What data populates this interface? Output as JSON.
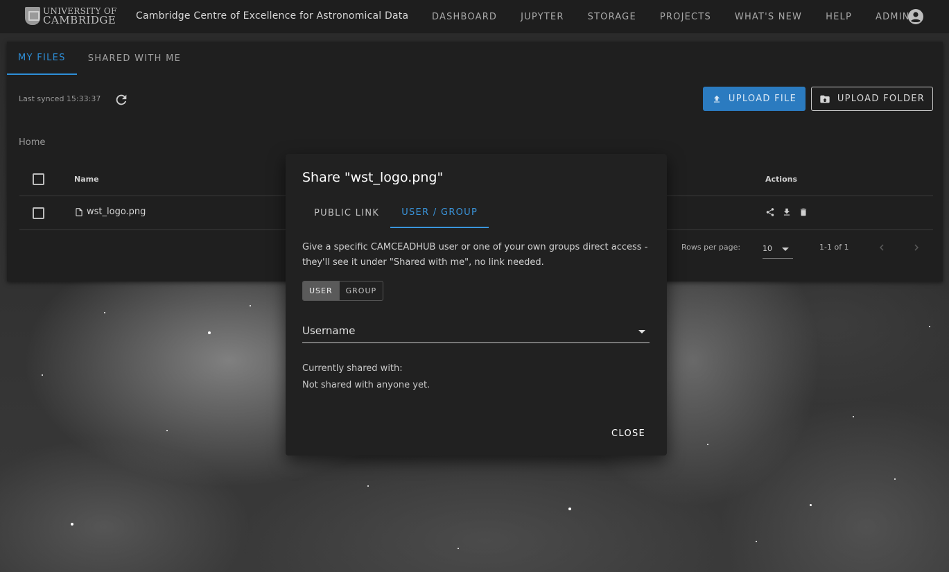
{
  "header": {
    "brand_line1": "UNIVERSITY OF",
    "brand_line2": "CAMBRIDGE",
    "app_title": "Cambridge Centre of Excellence for Astronomical Data",
    "nav": [
      "DASHBOARD",
      "JUPYTER",
      "STORAGE",
      "PROJECTS",
      "WHAT'S NEW",
      "HELP",
      "ADMIN"
    ]
  },
  "storage": {
    "tabs": [
      "MY FILES",
      "SHARED WITH ME"
    ],
    "active_tab": "MY FILES",
    "last_synced": "Last synced 15:33:37",
    "upload_file_label": "UPLOAD FILE",
    "upload_folder_label": "UPLOAD FOLDER",
    "breadcrumb": "Home",
    "columns": {
      "name": "Name",
      "actions": "Actions"
    },
    "files": [
      {
        "name": "wst_logo.png"
      }
    ],
    "pagination": {
      "rows_per_page_label": "Rows per page:",
      "rows_per_page": "10",
      "range": "1-1 of 1"
    }
  },
  "dialog": {
    "title": "Share \"wst_logo.png\"",
    "tabs": [
      "PUBLIC LINK",
      "USER / GROUP"
    ],
    "active_tab": "USER / GROUP",
    "description": "Give a specific CAMCEADHUB user or one of your own groups direct access - they'll see it under \"Shared with me\", no link needed.",
    "toggle": [
      "USER",
      "GROUP"
    ],
    "toggle_selected": "USER",
    "username_label": "Username",
    "shared_heading": "Currently shared with:",
    "shared_value": "Not shared with anyone yet.",
    "close_label": "CLOSE"
  },
  "colors": {
    "accent": "#2e8fd8",
    "primary_button": "#2b7bc0",
    "surface": "#1f1f1f",
    "appbar": "#1e1e1e"
  }
}
